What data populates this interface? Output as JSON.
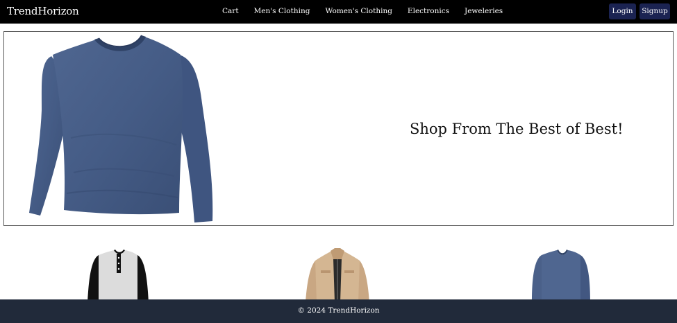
{
  "navbar": {
    "brand": "TrendHorizon",
    "links": [
      "Cart",
      "Men's Clothing",
      "Women's Clothing",
      "Electronics",
      "Jeweleries"
    ],
    "login_label": "Login",
    "signup_label": "Signup",
    "button_color": "#1b2352"
  },
  "hero": {
    "tagline": "Shop From The Best of Best!",
    "image": "blue-long-sleeve-v-neck-shirt"
  },
  "products": [
    {
      "image": "black-grey-henley-raglan-shirt"
    },
    {
      "image": "beige-utility-jacket"
    },
    {
      "image": "blue-long-sleeve-v-neck-shirt"
    }
  ],
  "footer": {
    "text": "© 2024 TrendHorizon",
    "background": "#212a3a"
  }
}
